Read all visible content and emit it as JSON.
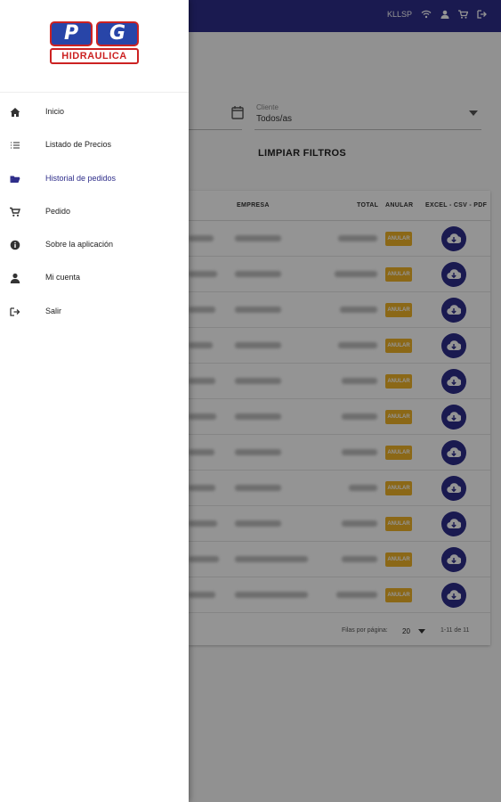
{
  "status_bar": {
    "carrier": "KLLSP"
  },
  "filters": {
    "client_label": "Cliente",
    "client_value": "Todos/as",
    "clear_button": "LIMPIAR FILTROS"
  },
  "table": {
    "headers": {
      "company": "EMPRESA",
      "total": "TOTAL",
      "cancel": "ANULAR",
      "export": "EXCEL - CSV - PDF"
    },
    "cancel_label": "ANULAR",
    "row_count": 11
  },
  "pagination": {
    "rows_per_page_label": "Filas por página:",
    "rows_per_page_value": "20",
    "range": "1-11 de 11"
  },
  "drawer": {
    "logo_letters": [
      "P",
      "G"
    ],
    "logo_text": "HIDRAULICA",
    "items": [
      {
        "label": "Inicio",
        "icon": "home-icon"
      },
      {
        "label": "Listado de Precios",
        "icon": "list-icon"
      },
      {
        "label": "Historial de pedidos",
        "icon": "folder-open-icon",
        "active": true
      },
      {
        "label": "Pedido",
        "icon": "cart-icon"
      },
      {
        "label": "Sobre la aplicación",
        "icon": "info-icon"
      },
      {
        "label": "Mi cuenta",
        "icon": "person-icon"
      },
      {
        "label": "Salir",
        "icon": "logout-icon"
      }
    ]
  },
  "colors": {
    "primary": "#2e2d8a",
    "accent": "#f0b429",
    "active_text": "#2e2d8a"
  }
}
